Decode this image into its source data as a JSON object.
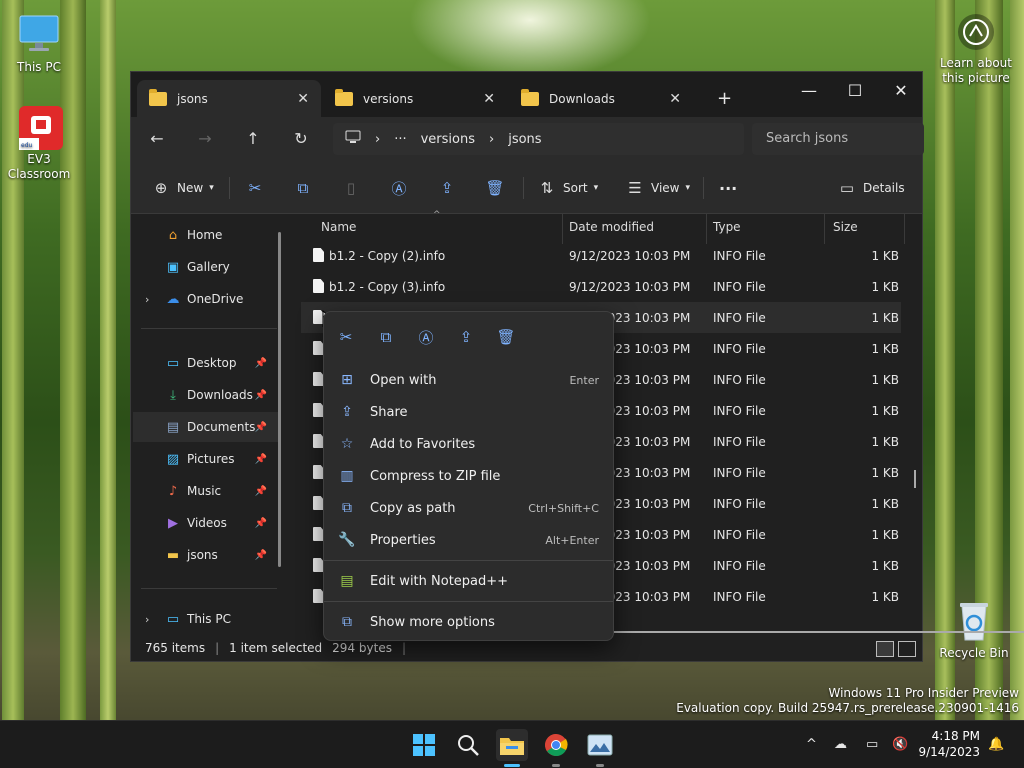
{
  "desktop": {
    "icons": [
      {
        "label": "This PC",
        "icon": "monitor-icon"
      },
      {
        "label": "EV3 Classroom",
        "icon": "ev3-icon"
      },
      {
        "label": "Recycle Bin",
        "icon": "recycle-bin-icon"
      }
    ],
    "learn_picture": "Learn about this picture",
    "watermark": [
      "Windows 11 Pro Insider Preview",
      "Evaluation copy. Build 25947.rs_prerelease.230901-1416"
    ]
  },
  "window": {
    "tabs": [
      {
        "label": "jsons",
        "active": true
      },
      {
        "label": "versions",
        "active": false
      },
      {
        "label": "Downloads",
        "active": false
      }
    ],
    "new_tab": "+",
    "controls": {
      "minimize": "—",
      "maximize": "☐",
      "close": "✕"
    },
    "address": {
      "ellipsis": "···",
      "crumbs": [
        "versions",
        "jsons"
      ],
      "search_placeholder": "Search jsons"
    },
    "toolbar": {
      "new_label": "New",
      "sort_label": "Sort",
      "view_label": "View",
      "more_label": "···",
      "details_label": "Details"
    },
    "nav": [
      {
        "label": "Home",
        "icon": "home-icon"
      },
      {
        "label": "Gallery",
        "icon": "gallery-icon"
      },
      {
        "label": "OneDrive",
        "icon": "cloud-icon"
      },
      {
        "label": "Desktop",
        "icon": "desktop-icon"
      },
      {
        "label": "Downloads",
        "icon": "download-icon"
      },
      {
        "label": "Documents",
        "icon": "documents-icon"
      },
      {
        "label": "Pictures",
        "icon": "pictures-icon"
      },
      {
        "label": "Music",
        "icon": "music-icon"
      },
      {
        "label": "Videos",
        "icon": "videos-icon"
      },
      {
        "label": "jsons",
        "icon": "folder-icon"
      },
      {
        "label": "This PC",
        "icon": "monitor-icon"
      }
    ],
    "columns": [
      "Name",
      "Date modified",
      "Type",
      "Size"
    ],
    "rows": [
      {
        "name": "b1.2 - Copy (2).info",
        "date": "9/12/2023 10:03 PM",
        "type": "INFO File",
        "size": "1 KB"
      },
      {
        "name": "b1.2 - Copy (3).info",
        "date": "9/12/2023 10:03 PM",
        "type": "INFO File",
        "size": "1 KB"
      },
      {
        "name": "",
        "date": "9/12/2023 10:03 PM",
        "type": "INFO File",
        "size": "1 KB"
      },
      {
        "name": "",
        "date": "9/12/2023 10:03 PM",
        "type": "INFO File",
        "size": "1 KB"
      },
      {
        "name": "",
        "date": "9/12/2023 10:03 PM",
        "type": "INFO File",
        "size": "1 KB"
      },
      {
        "name": "",
        "date": "9/12/2023 10:03 PM",
        "type": "INFO File",
        "size": "1 KB"
      },
      {
        "name": "",
        "date": "9/12/2023 10:03 PM",
        "type": "INFO File",
        "size": "1 KB"
      },
      {
        "name": "",
        "date": "9/12/2023 10:03 PM",
        "type": "INFO File",
        "size": "1 KB"
      },
      {
        "name": "",
        "date": "9/12/2023 10:03 PM",
        "type": "INFO File",
        "size": "1 KB"
      },
      {
        "name": "",
        "date": "9/12/2023 10:03 PM",
        "type": "INFO File",
        "size": "1 KB"
      },
      {
        "name": "",
        "date": "9/12/2023 10:03 PM",
        "type": "INFO File",
        "size": "1 KB"
      },
      {
        "name": "",
        "date": "9/12/2023 10:03 PM",
        "type": "INFO File",
        "size": "1 KB"
      }
    ],
    "status": {
      "count": "765 items",
      "selected": "1 item selected",
      "bytes": "294 bytes"
    }
  },
  "context_menu": {
    "quick_actions": [
      "cut-icon",
      "copy-icon",
      "rename-icon",
      "share-icon",
      "delete-icon"
    ],
    "items": [
      {
        "label": "Open with",
        "shortcut": "Enter",
        "icon": "open-with-icon"
      },
      {
        "label": "Share",
        "shortcut": "",
        "icon": "share-icon"
      },
      {
        "label": "Add to Favorites",
        "shortcut": "",
        "icon": "star-icon"
      },
      {
        "label": "Compress to ZIP file",
        "shortcut": "",
        "icon": "zip-icon"
      },
      {
        "label": "Copy as path",
        "shortcut": "Ctrl+Shift+C",
        "icon": "copy-path-icon"
      },
      {
        "label": "Properties",
        "shortcut": "Alt+Enter",
        "icon": "wrench-icon"
      },
      {
        "label": "Edit with Notepad++",
        "shortcut": "",
        "icon": "notepad-plus-plus-icon"
      },
      {
        "label": "Show more options",
        "shortcut": "",
        "icon": "more-options-icon"
      }
    ]
  },
  "taskbar": {
    "apps": [
      "start-icon",
      "search-icon",
      "file-explorer-icon",
      "chrome-icon",
      "photo-app-icon"
    ],
    "time": "4:18 PM",
    "date": "9/14/2023",
    "tray_chevron": "^"
  },
  "colors": {
    "accent": "#4cc2ff",
    "folder": "#f2c54b",
    "window_bg": "#202020"
  }
}
